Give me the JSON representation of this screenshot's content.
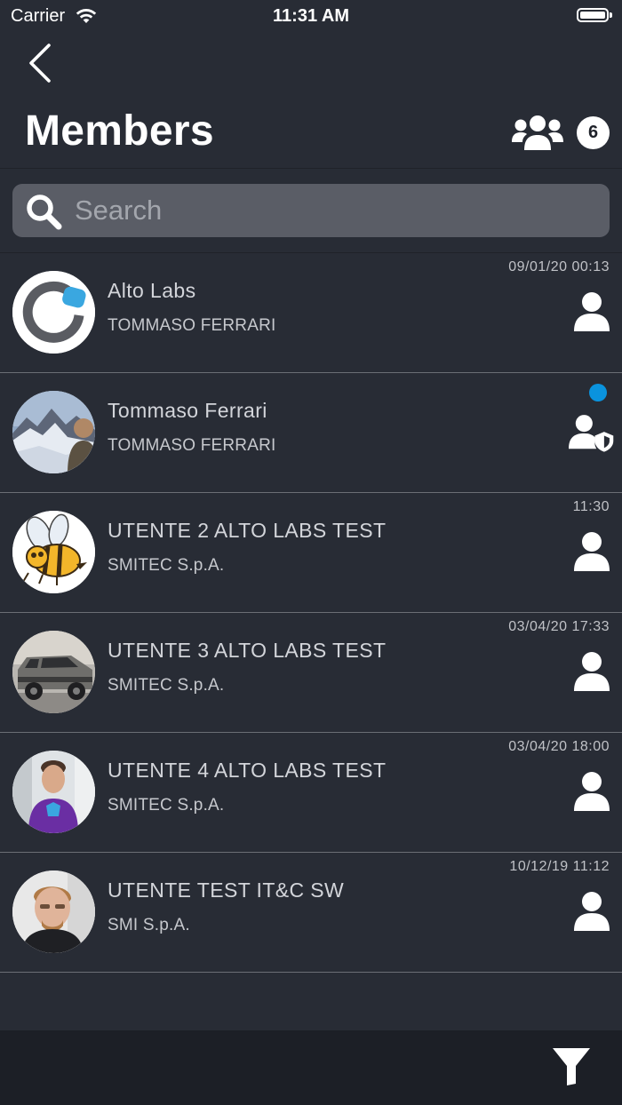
{
  "status_bar": {
    "carrier": "Carrier",
    "time": "11:31 AM"
  },
  "header": {
    "title": "Members",
    "member_count": "6",
    "back_icon": "chevron-left-icon",
    "group_icon": "users-group-icon"
  },
  "search": {
    "placeholder": "Search",
    "value": ""
  },
  "members": [
    {
      "name": "Alto Labs",
      "company": "TOMMASO FERRARI",
      "time": "09/01/20 00:13",
      "role": "user",
      "online": false,
      "avatar": "alto-labs-logo"
    },
    {
      "name": "Tommaso Ferrari",
      "company": "TOMMASO FERRARI",
      "time": "",
      "role": "admin",
      "online": true,
      "avatar": "mountain-photo"
    },
    {
      "name": "UTENTE 2 ALTO LABS TEST",
      "company": "SMITEC S.p.A.",
      "time": "11:30",
      "role": "user",
      "online": false,
      "avatar": "bee-cartoon"
    },
    {
      "name": "UTENTE 3 ALTO LABS TEST",
      "company": "SMITEC S.p.A.",
      "time": "03/04/20 17:33",
      "role": "user",
      "online": false,
      "avatar": "car-photo"
    },
    {
      "name": "UTENTE 4 ALTO LABS TEST",
      "company": "SMITEC S.p.A.",
      "time": "03/04/20 18:00",
      "role": "user",
      "online": false,
      "avatar": "person-purple-shirt-photo"
    },
    {
      "name": "UTENTE TEST IT&C SW",
      "company": "SMI S.p.A.",
      "time": "10/12/19 11:12",
      "role": "user",
      "online": false,
      "avatar": "person-portrait-photo"
    }
  ],
  "toolbar": {
    "filter_icon": "filter-icon"
  },
  "colors": {
    "background": "#282c35",
    "search_field": "#5a5d66",
    "toolbar": "#1c1f26",
    "online_dot": "#0a93de",
    "logo_accent": "#3aa7e0"
  }
}
